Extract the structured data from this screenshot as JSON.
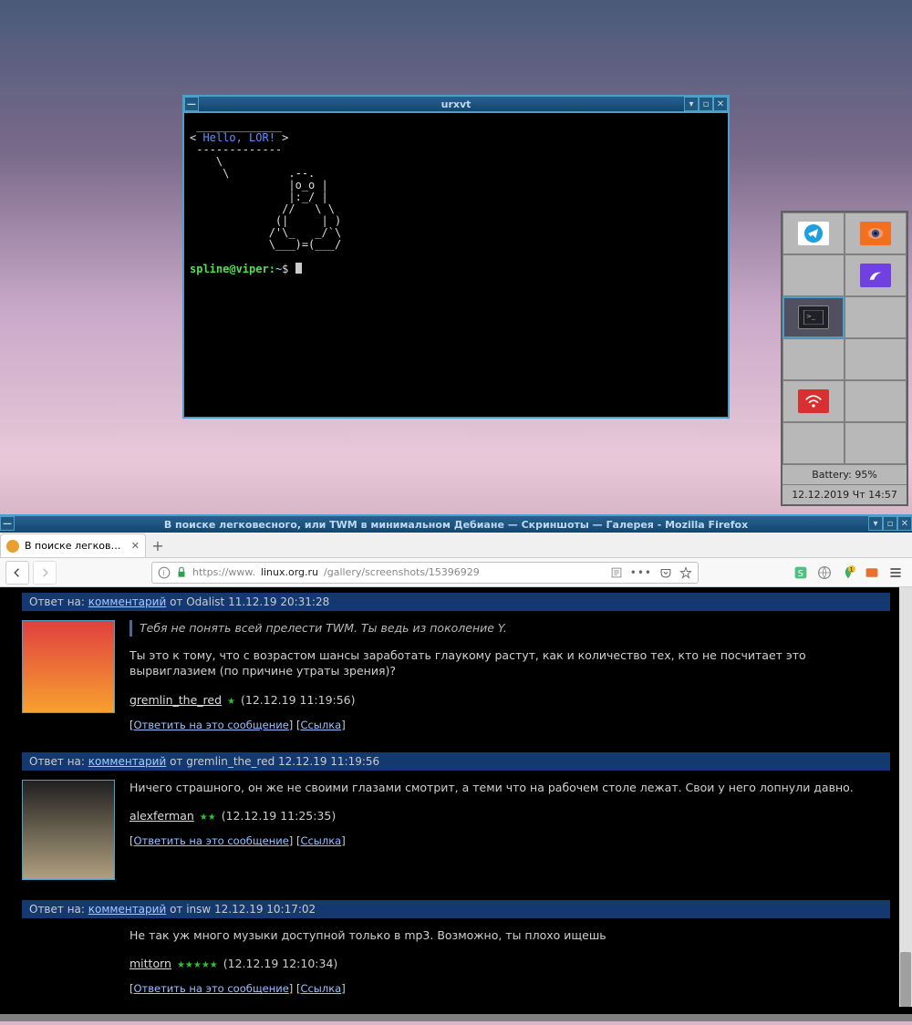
{
  "terminal": {
    "title": "urxvt",
    "ascii_top": " _____________ ",
    "ascii_msg_l": "< ",
    "ascii_msg": "Hello, LOR!",
    "ascii_msg_r": " >",
    "ascii_bot": " ------------- ",
    "cow1": "    \\",
    "cow2": "     \\         .--.",
    "cow3": "               |o_o |",
    "cow4": "               |:_/ |",
    "cow5": "              //   \\ \\",
    "cow6": "             (|     | )",
    "cow7": "            /'\\_   _/`\\",
    "cow8": "            \\___)=(___/",
    "prompt_user": "spline@viper",
    "prompt_sep": ":",
    "prompt_path": "~",
    "prompt_sym": "$ "
  },
  "panel": {
    "battery": "Battery: 95%",
    "clock": "12.12.2019 Чт 14:57"
  },
  "firefox": {
    "title": "В поиске легковесного, или TWM в минимальном Дебиане — Скриншоты — Галерея - Mozilla Firefox",
    "tab_title": "В поиске легковесного",
    "url_prefix": "https://www.",
    "url_domain": "linux.org.ru",
    "url_path": "/gallery/screenshots/15396929"
  },
  "comments": [
    {
      "reply_to_prefix": "Ответ на: ",
      "reply_to_link": "комментарий",
      "reply_to_meta": " от Odalist 11.12.19 20:31:28",
      "quote": "Тебя не понять всей прелести TWM. Ты ведь из поколение Y.",
      "text": "Ты это к тому, что с возрастом шансы заработать глаукому растут, как и количество тех, кто не посчитает это вырвиглазием (по причине утраты зрения)?",
      "author": "gremlin_the_red",
      "stars": "★",
      "time": " (12.12.19 11:19:56)",
      "reply": "Ответить на это сообщение",
      "link": "Ссылка",
      "avatar_class": "av1"
    },
    {
      "reply_to_prefix": "Ответ на: ",
      "reply_to_link": "комментарий",
      "reply_to_meta": " от gremlin_the_red 12.12.19 11:19:56",
      "quote": "",
      "text": "Ничего страшного, он же не своими глазами смотрит, а теми что на рабочем столе лежат. Свои у него лопнули давно.",
      "author": "alexferman",
      "stars": "★★",
      "time": " (12.12.19 11:25:35)",
      "reply": "Ответить на это сообщение",
      "link": "Ссылка",
      "avatar_class": "av2"
    },
    {
      "reply_to_prefix": "Ответ на: ",
      "reply_to_link": "комментарий",
      "reply_to_meta": " от insw 12.12.19 10:17:02",
      "quote": "",
      "text": "Не так уж много музыки доступной только в mp3. Возможно, ты плохо ищешь",
      "author": "mittorn",
      "stars": "★★★★★",
      "time": " (12.12.19 12:10:34)",
      "reply": "Ответить на это сообщение",
      "link": "Ссылка",
      "avatar_class": "none"
    }
  ]
}
